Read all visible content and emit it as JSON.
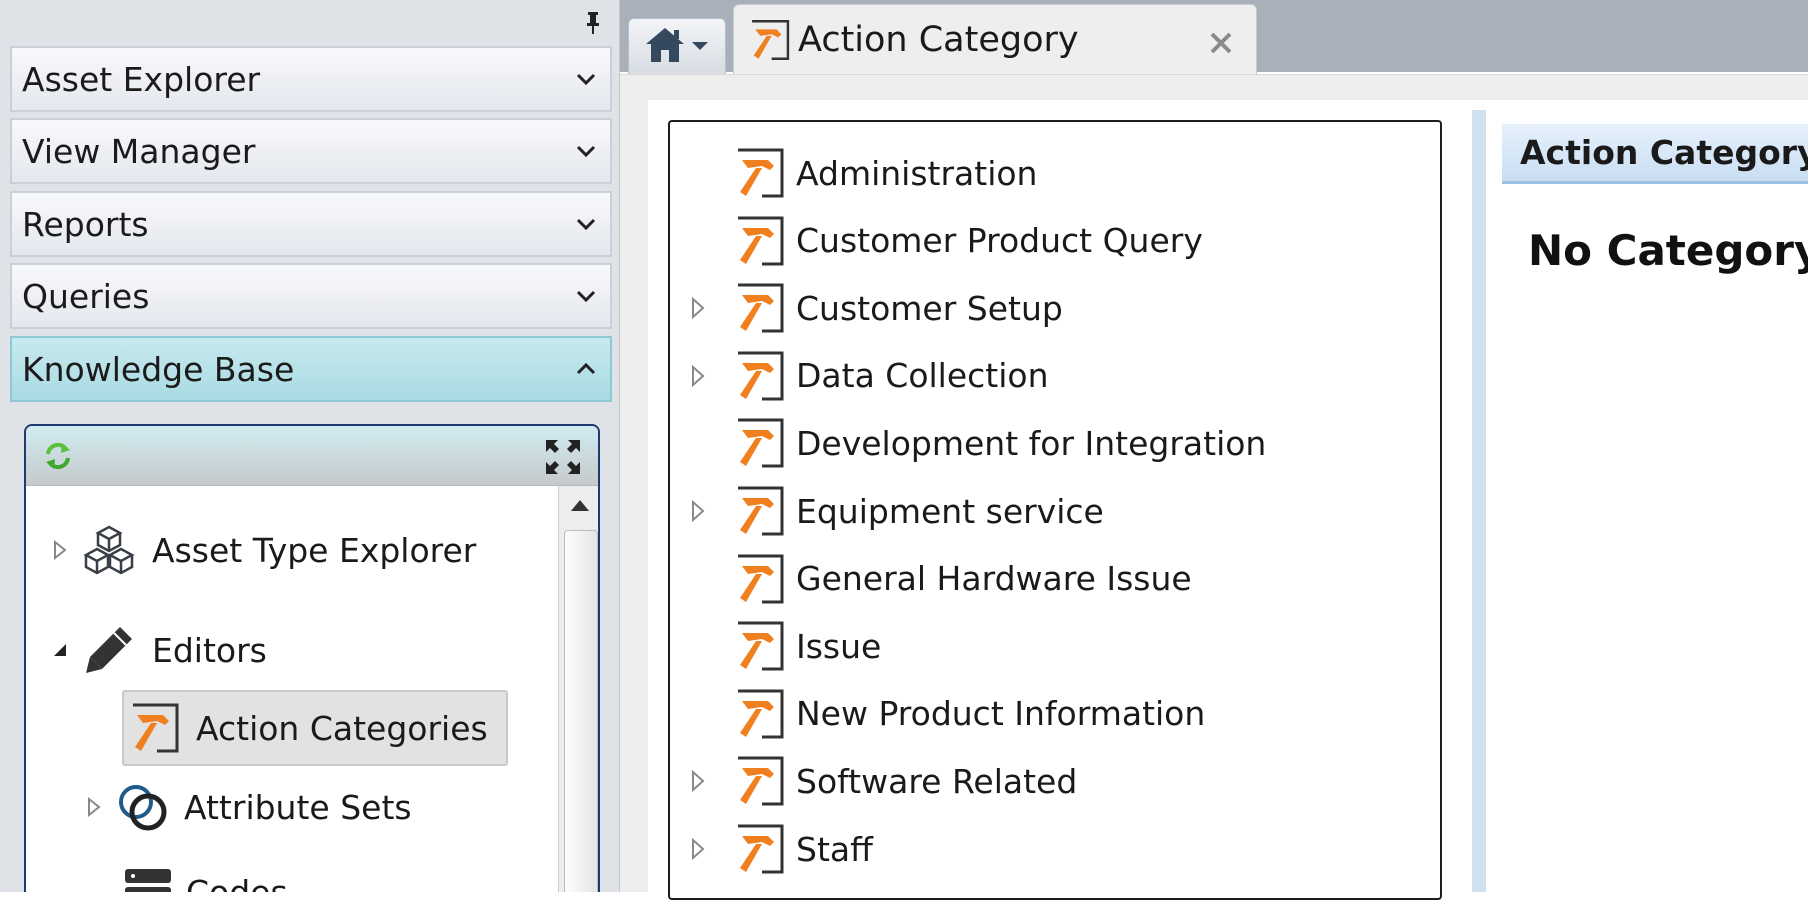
{
  "nav": {
    "sections": [
      {
        "label": "Asset Explorer",
        "state": "collapsed"
      },
      {
        "label": "View Manager",
        "state": "collapsed"
      },
      {
        "label": "Reports",
        "state": "collapsed"
      },
      {
        "label": "Queries",
        "state": "collapsed"
      },
      {
        "label": "Knowledge Base",
        "state": "expanded"
      }
    ],
    "pin_icon": "pin-icon"
  },
  "knowledge_base": {
    "toolbar": {
      "refresh_icon": "refresh-icon",
      "expand_icon": "fullscreen-icon"
    },
    "tree": [
      {
        "label": "Asset Type Explorer",
        "icon": "cubes-icon",
        "expander": "collapsed"
      },
      {
        "label": "Editors",
        "icon": "pencil-icon",
        "expander": "expanded"
      },
      {
        "label": "Action Categories",
        "icon": "hammer-icon",
        "selected": true
      },
      {
        "label": "Attribute Sets",
        "icon": "rings-icon",
        "expander": "collapsed"
      },
      {
        "label": "Codes",
        "icon": "server-icon"
      }
    ]
  },
  "tabs": {
    "home_icon": "home-icon",
    "active": {
      "label": "Action Category",
      "icon": "hammer-icon"
    }
  },
  "categories": [
    {
      "label": "Administration",
      "expandable": false
    },
    {
      "label": "Customer Product Query",
      "expandable": false
    },
    {
      "label": "Customer Setup",
      "expandable": true
    },
    {
      "label": "Data Collection",
      "expandable": true
    },
    {
      "label": "Development for Integration",
      "expandable": false
    },
    {
      "label": "Equipment service",
      "expandable": true
    },
    {
      "label": "General Hardware Issue",
      "expandable": false
    },
    {
      "label": "Issue",
      "expandable": false
    },
    {
      "label": "New Product Information",
      "expandable": false
    },
    {
      "label": "Software Related",
      "expandable": true
    },
    {
      "label": "Staff",
      "expandable": true
    }
  ],
  "detail": {
    "header": "Action Category",
    "message": "No Category"
  },
  "colors": {
    "accent_hammer": "#f07f1f",
    "selected_section": "#b3e0e7",
    "panel_border": "#1c3a70"
  }
}
